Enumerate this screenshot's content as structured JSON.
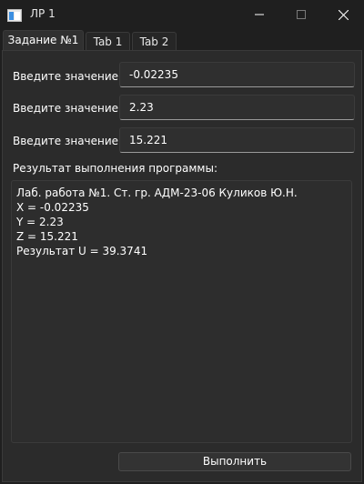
{
  "window": {
    "title": "ЛР 1",
    "icon": "app-window-icon",
    "controls": {
      "minimize": "minimize-icon",
      "maximize": "maximize-icon",
      "close": "close-icon"
    }
  },
  "tabs": [
    {
      "label": "Задание №1",
      "active": true
    },
    {
      "label": "Tab 1",
      "active": false
    },
    {
      "label": "Tab 2",
      "active": false
    }
  ],
  "form": {
    "x_label": "Введите значение X:",
    "x_value": "-0.02235",
    "y_label": "Введите значение Y:",
    "y_value": "2.23",
    "z_label": "Введите значение Z:",
    "z_value": "15.221",
    "result_label": "Результат выполнения программы:"
  },
  "output": {
    "lines": [
      "Лаб. работа №1. Ст. гр. АДМ-23-06 Куликов Ю.Н.",
      "X = -0.02235",
      "Y = 2.23",
      "Z = 15.221",
      "Результат U = 39.3741"
    ]
  },
  "actions": {
    "run_label": "Выполнить"
  }
}
